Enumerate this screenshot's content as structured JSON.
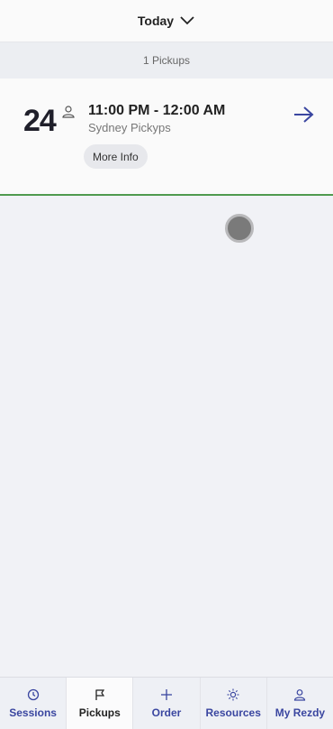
{
  "header": {
    "title": "Today"
  },
  "summary": {
    "count_text": "1 Pickups"
  },
  "pickup": {
    "day": "24",
    "time_range": "11:00 PM - 12:00 AM",
    "name": "Sydney Pickyps",
    "more_info_label": "More Info"
  },
  "tabs": [
    {
      "label": "Sessions",
      "icon": "clock-icon",
      "active": false
    },
    {
      "label": "Pickups",
      "icon": "flag-icon",
      "active": true
    },
    {
      "label": "Order",
      "icon": "plus-icon",
      "active": false
    },
    {
      "label": "Resources",
      "icon": "sun-icon",
      "active": false
    },
    {
      "label": "My Rezdy",
      "icon": "user-icon",
      "active": false
    }
  ],
  "colors": {
    "accent": "#3a46a0",
    "card_border": "#4f9a4f",
    "background": "#f1f2f6"
  }
}
